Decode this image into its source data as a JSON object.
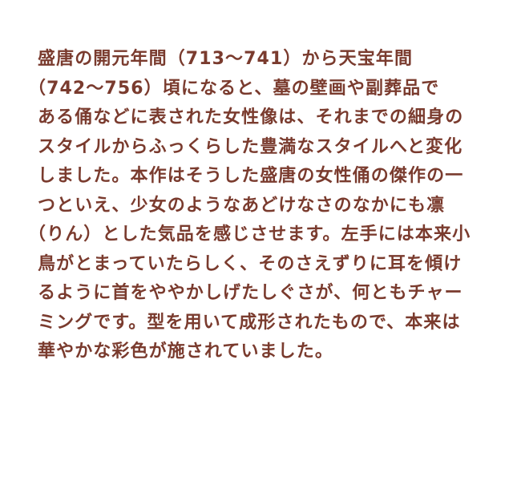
{
  "description": {
    "lines": [
      "盛唐の開元年間（713〜741）から天宝年間",
      "（742〜756）頃になると、墓の壁画や副葬品で",
      "ある俑などに表された女性像は、それまでの細身の",
      "スタイルからふっくらした豊満なスタイルへと変化",
      "しました。本作はそうした盛唐の女性俑の傑作の一",
      "つといえ、少女のようなあどけなさのなかにも凛",
      "（りん）とした気品を感じさせます。左手には本来小",
      "鳥がとまっていたらしく、そのさえずりに耳を傾け",
      "るように首をややかしげたしぐさが、何ともチャー",
      "ミングです。型を用いて成形されたもので、本来は",
      "華やかな彩色が施されていました。"
    ]
  },
  "text_color": "#7a3b2e"
}
